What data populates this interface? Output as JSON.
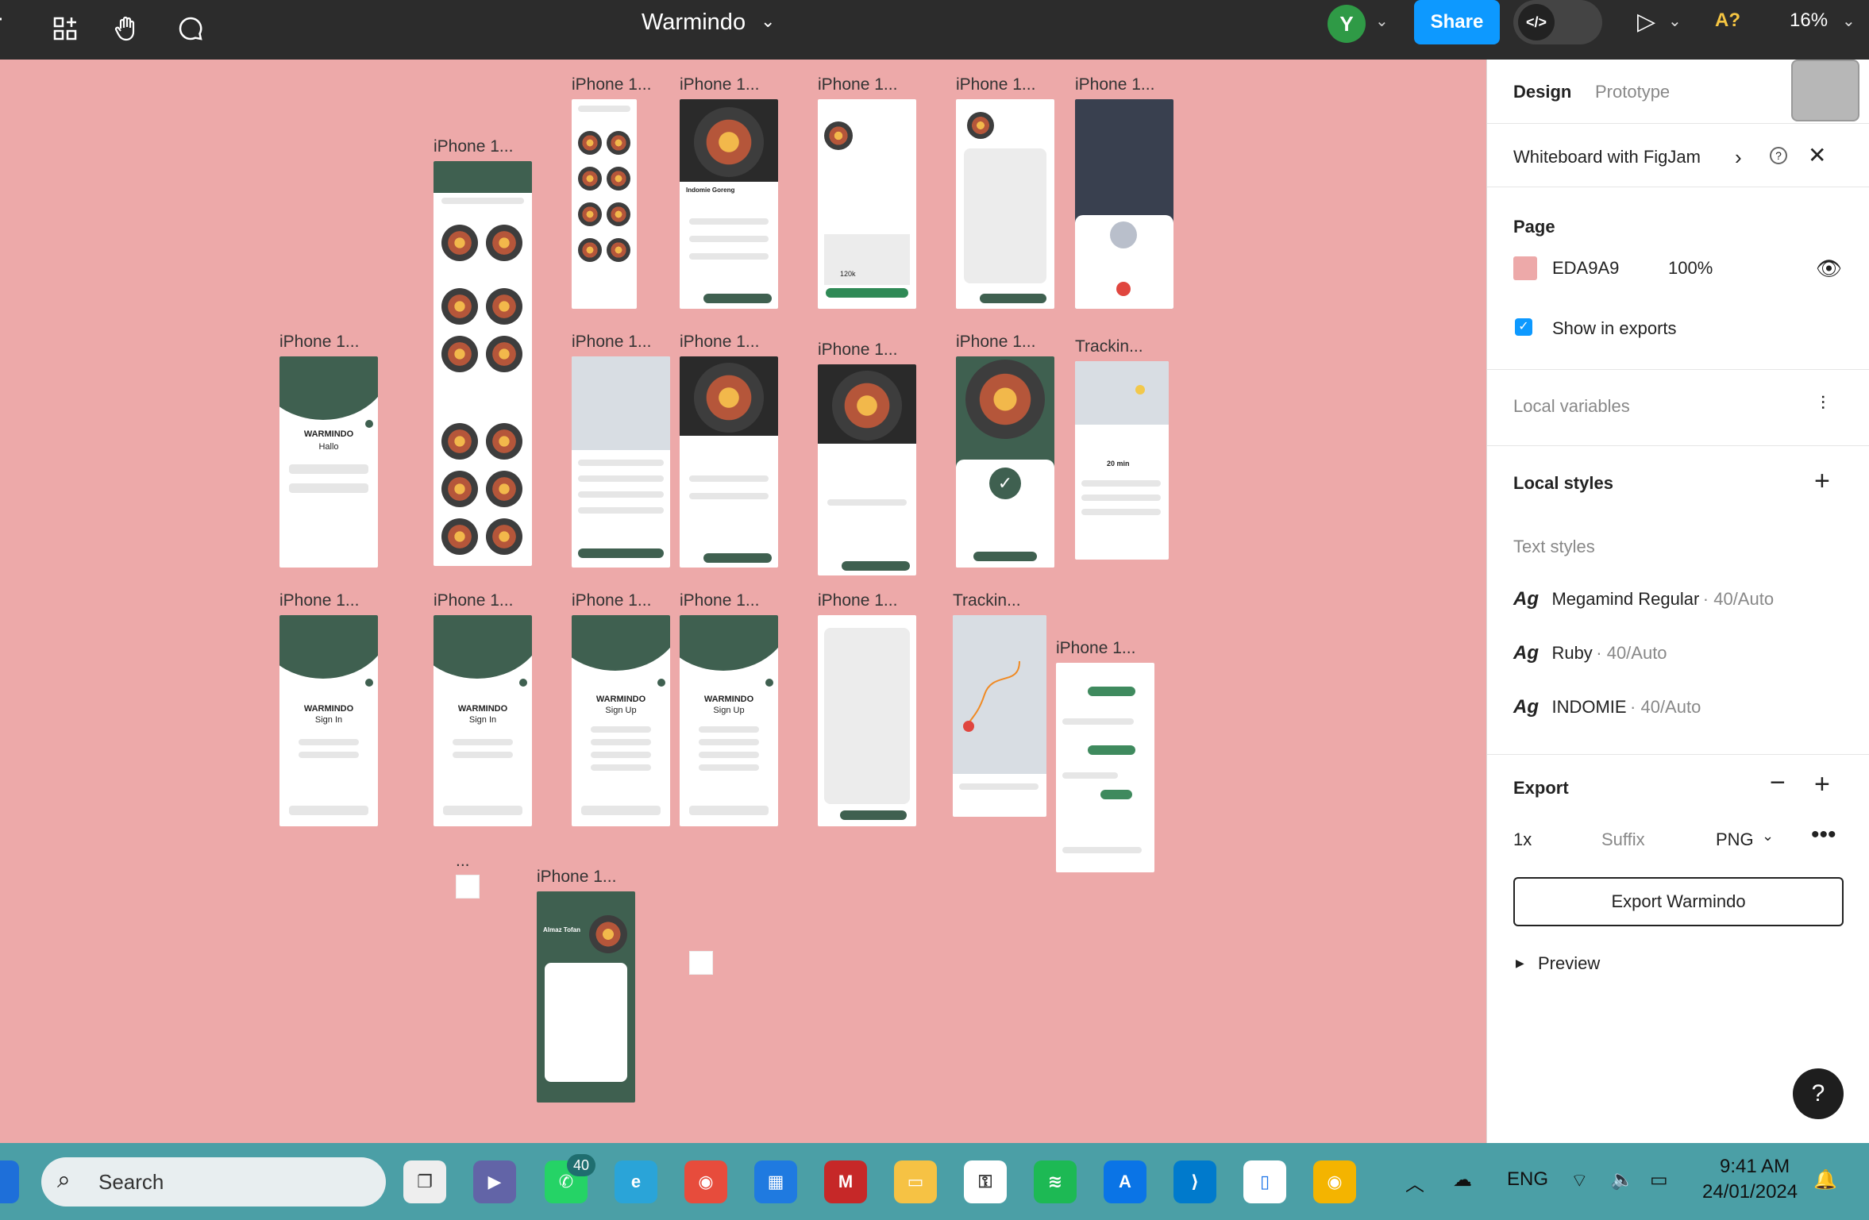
{
  "toolbar": {
    "file_title": "Warmindo",
    "avatar_initial": "Y",
    "share_label": "Share",
    "dev_mode_icon": "</>",
    "a_label": "A?",
    "zoom": "16%"
  },
  "panel": {
    "tab_design": "Design",
    "tab_prototype": "Prototype",
    "whiteboard": "Whiteboard with FigJam",
    "page_heading": "Page",
    "page_color": "EDA9A9",
    "page_opacity": "100%",
    "show_in_exports": "Show in exports",
    "local_variables": "Local variables",
    "local_styles": "Local styles",
    "text_styles_heading": "Text styles",
    "text_styles": [
      {
        "ag": "Ag",
        "name": "Megamind Regular",
        "meta": "· 40/Auto"
      },
      {
        "ag": "Ag",
        "name": "Ruby",
        "meta": "· 40/Auto"
      },
      {
        "ag": "Ag",
        "name": "INDOMIE",
        "meta": "· 40/Auto"
      }
    ],
    "export_heading": "Export",
    "export_scale": "1x",
    "export_suffix": "Suffix",
    "export_format": "PNG",
    "export_button": "Export Warmindo",
    "preview": "Preview"
  },
  "canvas": {
    "page_color": "#EDA9A9",
    "frame_labels": {
      "f1": "iPhone 1...",
      "f2": "iPhone 1...",
      "f3": "iPhone 1...",
      "f4": "iPhone 1...",
      "f5": "iPhone 1...",
      "f6": "iPhone 1...",
      "f7": "iPhone 1...",
      "f8": "iPhone 1...",
      "f9": "iPhone 1...",
      "f10": "iPhone 1...",
      "f11": "iPhone 1...",
      "f12": "Trackin...",
      "f13": "iPhone 1...",
      "f14": "iPhone 1...",
      "f15": "iPhone 1...",
      "f16": "iPhone 1...",
      "f17": "iPhone 1...",
      "f18": "Trackin...",
      "f19": "iPhone 1...",
      "f20": "...",
      "f21": "iPhone 1..."
    },
    "screens": {
      "brand": "WARMINDO",
      "hallo": "Hallo",
      "sign_in": "Sign In",
      "sign_up": "Sign Up",
      "menu_item": "Indomie Goreng",
      "price": "120k",
      "eta": "20 min",
      "profile_name": "Almaz Tofan"
    }
  },
  "taskbar": {
    "search": "Search",
    "whatsapp_badge": "40",
    "lang": "ENG",
    "time": "9:41 AM",
    "date": "24/01/2024"
  }
}
